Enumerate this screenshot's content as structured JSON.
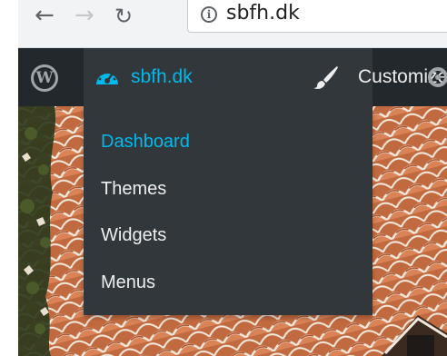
{
  "browser": {
    "back_icon": "arrow-left-icon",
    "forward_icon": "arrow-right-icon",
    "reload_icon": "reload-icon",
    "info_icon": "info-icon",
    "info_glyph": "i",
    "url": "sbfh.dk"
  },
  "admin_bar": {
    "logo_icon": "wordpress-logo-icon",
    "site_name": "sbfh.dk",
    "site_icon": "dashboard-gauge-icon",
    "customize_label": "Customize",
    "customize_icon": "paintbrush-icon",
    "accent_color": "#00b9eb",
    "background_color": "#23282d"
  },
  "site_menu": {
    "items": [
      {
        "label": "Dashboard",
        "active": true
      },
      {
        "label": "Themes",
        "active": false
      },
      {
        "label": "Widgets",
        "active": false
      },
      {
        "label": "Menus",
        "active": false
      }
    ],
    "background_color": "#32373c"
  }
}
